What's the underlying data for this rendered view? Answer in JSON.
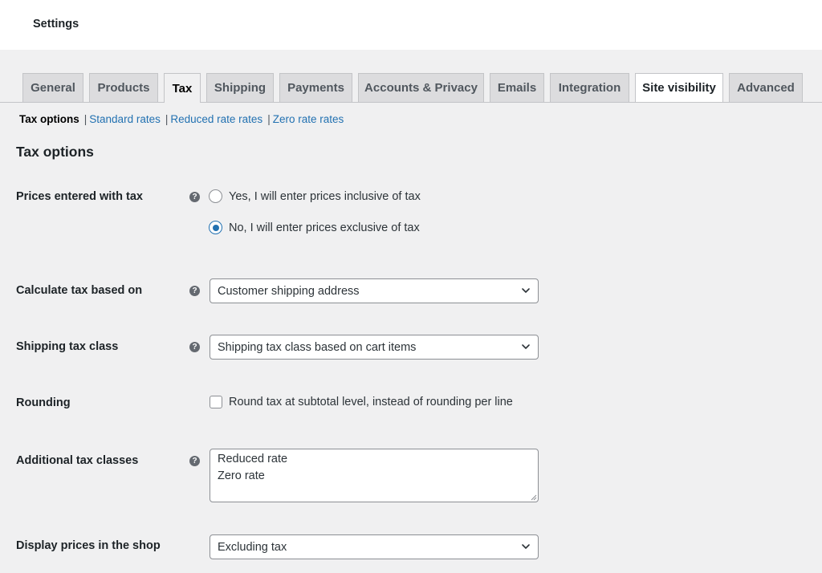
{
  "header": {
    "title": "Settings"
  },
  "tabs": [
    {
      "label": "General"
    },
    {
      "label": "Products"
    },
    {
      "label": "Tax"
    },
    {
      "label": "Shipping"
    },
    {
      "label": "Payments"
    },
    {
      "label": "Accounts & Privacy"
    },
    {
      "label": "Emails"
    },
    {
      "label": "Integration"
    },
    {
      "label": "Site visibility"
    },
    {
      "label": "Advanced"
    }
  ],
  "active_tab": "Tax",
  "subnav": {
    "current": "Tax options",
    "links": [
      "Standard rates",
      "Reduced rate rates",
      "Zero rate rates"
    ]
  },
  "section": {
    "title": "Tax options"
  },
  "fields": {
    "prices_entered": {
      "label": "Prices entered with tax",
      "options": [
        {
          "label": "Yes, I will enter prices inclusive of tax",
          "checked": false
        },
        {
          "label": "No, I will enter prices exclusive of tax",
          "checked": true
        }
      ]
    },
    "calc_based_on": {
      "label": "Calculate tax based on",
      "value": "Customer shipping address"
    },
    "shipping_tax_class": {
      "label": "Shipping tax class",
      "value": "Shipping tax class based on cart items"
    },
    "rounding": {
      "label": "Rounding",
      "checkbox_label": "Round tax at subtotal level, instead of rounding per line",
      "checked": false
    },
    "additional_classes": {
      "label": "Additional tax classes",
      "lines": [
        "Reduced rate",
        "Zero rate"
      ]
    },
    "display_prices": {
      "label": "Display prices in the shop",
      "value": "Excluding tax"
    }
  },
  "icons": {
    "help": "help-circle-icon",
    "chevron": "chevron-down-icon"
  },
  "colors": {
    "accent": "#2271b1",
    "background": "#f0f0f1"
  }
}
